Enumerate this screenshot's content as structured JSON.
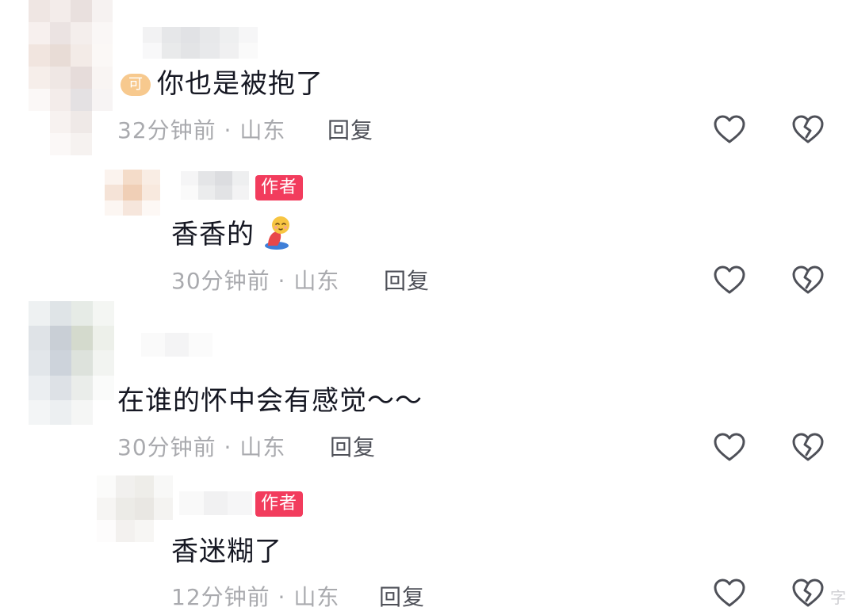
{
  "comments": [
    {
      "text": "你也是被抱了",
      "time": "32分钟前",
      "separator": "·",
      "location": "山东",
      "reply_label": "回复"
    },
    {
      "text": "香香的",
      "time": "30分钟前",
      "separator": "·",
      "location": "山东",
      "reply_label": "回复",
      "badge": "作者",
      "emoji": "pleading-kneeling-emoji"
    },
    {
      "text": "在谁的怀中会有感觉～～",
      "time": "30分钟前",
      "separator": "·",
      "location": "山东",
      "reply_label": "回复"
    },
    {
      "text": "香迷糊了",
      "time": "12分钟前",
      "separator": "·",
      "location": "山东",
      "reply_label": "回复",
      "badge": "作者"
    }
  ],
  "first_comment_prefix_badge": "可",
  "icons": {
    "like": "heart-outline-icon",
    "dislike": "broken-heart-icon"
  },
  "colors": {
    "author_badge": "#f23c5d",
    "meta_text": "#a9aaae",
    "reply_text": "#4e5058",
    "comment_text": "#161823"
  },
  "watermark": "字"
}
